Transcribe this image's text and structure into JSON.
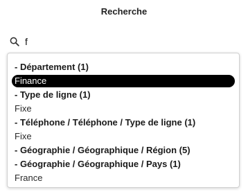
{
  "panel": {
    "title": "Recherche"
  },
  "search": {
    "value": "f",
    "placeholder": ""
  },
  "results": [
    {
      "type": "header",
      "label": "- Département (1)"
    },
    {
      "type": "option",
      "label": "Finance",
      "selected": true
    },
    {
      "type": "header",
      "label": "- Type de ligne (1)"
    },
    {
      "type": "option",
      "label": "Fixe",
      "selected": false
    },
    {
      "type": "header",
      "label": "- Téléphone / Téléphone / Type de ligne (1)"
    },
    {
      "type": "option",
      "label": "Fixe",
      "selected": false
    },
    {
      "type": "header",
      "label": "- Géographie / Géographique / Région (5)"
    },
    {
      "type": "header",
      "label": "- Géographie / Géographique / Pays (1)"
    },
    {
      "type": "option",
      "label": "France",
      "selected": false
    }
  ],
  "colors": {
    "selected_bg": "#000000",
    "selected_text": "#ffffff",
    "border": "#d0d0d0"
  },
  "icons": {
    "search": "search-icon"
  }
}
